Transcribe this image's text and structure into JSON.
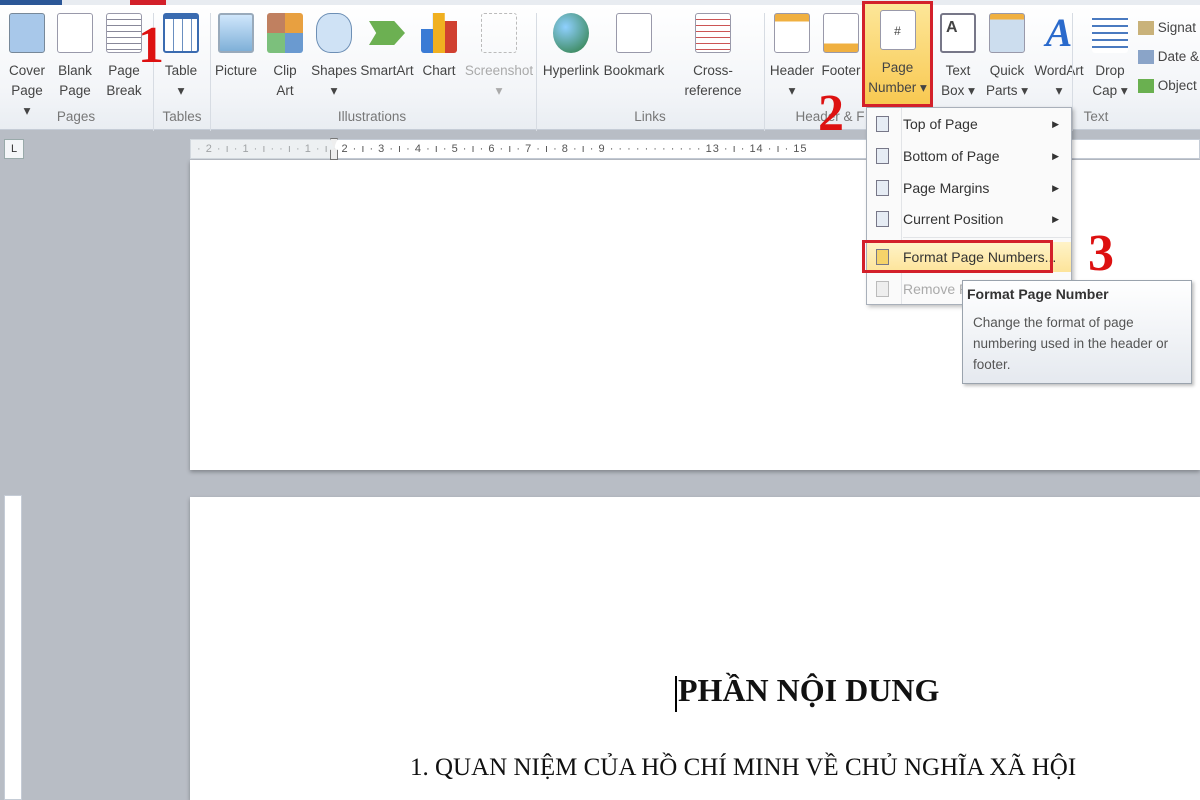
{
  "ribbon": {
    "buttons": [
      {
        "l1": "Cover",
        "l2": "Page ▾"
      },
      {
        "l1": "Blank",
        "l2": "Page"
      },
      {
        "l1": "Page",
        "l2": "Break"
      },
      {
        "l1": "Table",
        "l2": "▾"
      },
      {
        "l1": "Picture",
        "l2": ""
      },
      {
        "l1": "Clip",
        "l2": "Art"
      },
      {
        "l1": "Shapes",
        "l2": "▾"
      },
      {
        "l1": "SmartArt",
        "l2": ""
      },
      {
        "l1": "Chart",
        "l2": ""
      },
      {
        "l1": "Screenshot",
        "l2": "▾"
      },
      {
        "l1": "Hyperlink",
        "l2": ""
      },
      {
        "l1": "Bookmark",
        "l2": ""
      },
      {
        "l1": "Cross-reference",
        "l2": ""
      },
      {
        "l1": "Header",
        "l2": "▾"
      },
      {
        "l1": "Footer",
        "l2": ""
      },
      {
        "l1": "Page",
        "l2": "Number ▾"
      },
      {
        "l1": "Text",
        "l2": "Box ▾"
      },
      {
        "l1": "Quick",
        "l2": "Parts ▾"
      },
      {
        "l1": "WordArt",
        "l2": "▾"
      },
      {
        "l1": "Drop",
        "l2": "Cap ▾"
      }
    ],
    "small": [
      "Signat",
      "Date &",
      "Object"
    ],
    "groups": [
      "Pages",
      "Tables",
      "Illustrations",
      "Links",
      "Header & F",
      "Text"
    ]
  },
  "ruler": {
    "tab_selector": "L",
    "text": "· 2 · ı · 1 · ı ·   · ı · 1 · ı · 2 · ı · 3 · ı · 4 · ı · 5 · ı · 6 · ı · 7 · ı · 8 · ı · 9 ·  ·  ·  ·  ·  ·  ·  ·  ·  ·  · 13 · ı · 14 · ı · 15"
  },
  "menu": {
    "items": [
      {
        "label": "Top of Page",
        "submenu": true
      },
      {
        "label": "Bottom of Page",
        "submenu": true
      },
      {
        "label": "Page Margins",
        "submenu": true
      },
      {
        "label": "Current Position",
        "submenu": true
      },
      {
        "label": "Format Page Numbers...",
        "highlighted": true
      },
      {
        "label": "Remove Page Numbers",
        "disabled": true
      }
    ]
  },
  "tooltip": {
    "title": "Format Page Number",
    "body": "Change the format of page numbering used in the header or footer."
  },
  "annotations": [
    "1",
    "2",
    "3"
  ],
  "document": {
    "heading": "PHẦN NỘI DUNG",
    "line1": "1.  QUAN NIỆM CỦA HỒ CHÍ MINH VỀ CHỦ NGHĨA XÃ HỘI"
  },
  "colors": {
    "annotation": "#d3202a",
    "highlight": "#fde49a"
  }
}
